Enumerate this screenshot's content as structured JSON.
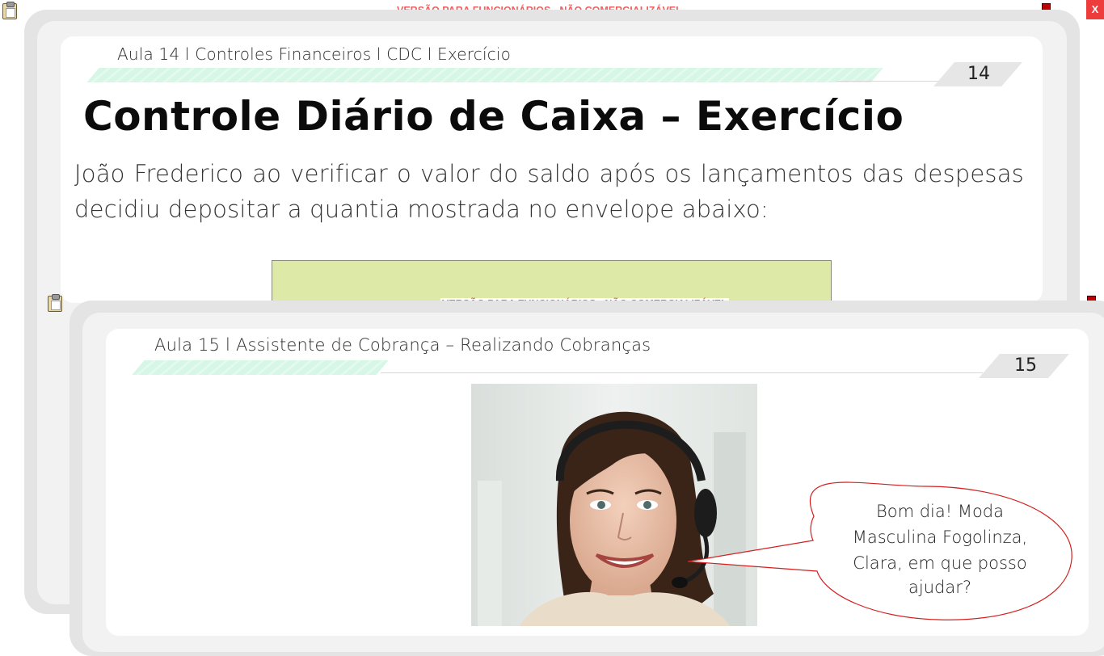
{
  "window": {
    "watermark": "VERSÃO PARA FUNCIONÁRIOS - NÃO COMERCIALIZÁVEL",
    "close_label": "X"
  },
  "slide_back": {
    "header": "Aula 14 l Controles Financeiros l CDC l Exercício",
    "number": "14",
    "title": "Controle Diário de Caixa – Exercício",
    "paragraph_line1": "João Frederico ao verificar o valor do saldo após os lançamentos das despesas",
    "paragraph_line2": "decidiu depositar a quantia mostrada no envelope abaixo:"
  },
  "slide_front": {
    "header": "Aula 15 l Assistente de Cobrança – Realizando Cobranças",
    "number": "15",
    "speech_bubble": {
      "line1": "Bom dia! Moda",
      "line2": "Masculina Fogolinza,",
      "line3": "Clara, em que posso",
      "line4": "ajudar?"
    }
  },
  "icons": {
    "clipboard": "clipboard-icon",
    "network": "network-status-icon"
  }
}
